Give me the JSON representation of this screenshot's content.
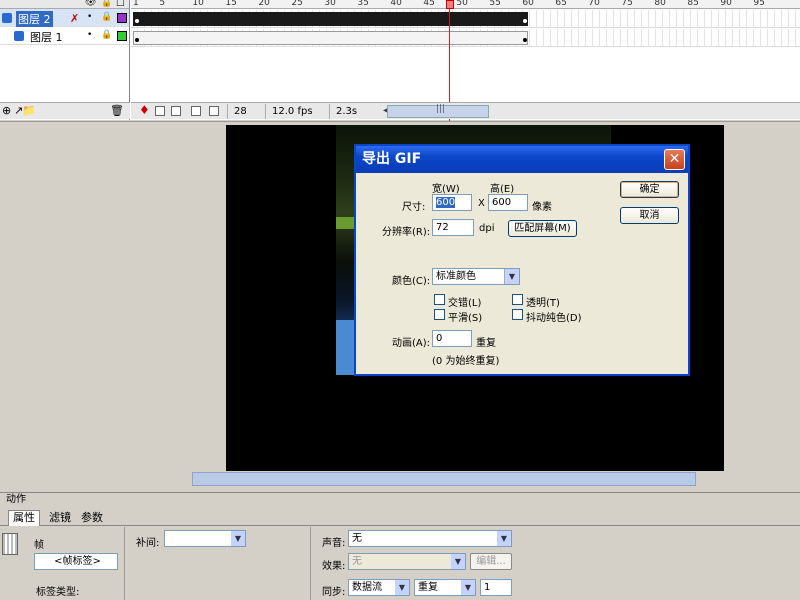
{
  "timeline": {
    "ruler_ticks": [
      "1",
      "5",
      "10",
      "15",
      "20",
      "25",
      "30",
      "35",
      "40",
      "45",
      "50",
      "55",
      "60",
      "65",
      "70",
      "75",
      "80",
      "85",
      "90",
      "95"
    ],
    "layers": [
      {
        "name": "图层 2",
        "selected": true,
        "color": "#9933cc"
      },
      {
        "name": "图层 1",
        "selected": false,
        "color": "#33cc33"
      }
    ],
    "current_frame": "28",
    "fps": "12.0 fps",
    "elapsed": "2.3s"
  },
  "dialog": {
    "title": "导出 GIF",
    "width_label": "宽(W)",
    "height_label": "高(E)",
    "size_label": "尺寸:",
    "width_value": "600",
    "x_sep": "X",
    "height_value": "600",
    "unit": "像素",
    "resolution_label": "分辨率(R):",
    "resolution_value": "72",
    "dpi": "dpi",
    "match_screen": "匹配屏幕(M)",
    "color_label": "颜色(C):",
    "color_value": "标准颜色",
    "interlace": "交错(L)",
    "transparent": "透明(T)",
    "smooth": "平滑(S)",
    "dither": "抖动纯色(D)",
    "animation_label": "动画(A):",
    "animation_value": "0",
    "repeat": "重复",
    "repeat_hint": "(0 为始终重复)",
    "ok": "确定",
    "cancel": "取消",
    "close_glyph": "✕"
  },
  "panels": {
    "actions": "动作",
    "tabs": [
      "属性",
      "滤镜",
      "参数"
    ],
    "frame_label": "帧",
    "frame_label_input": "<帧标签>",
    "label_type": "标签类型:",
    "tween_label": "补间:",
    "tween_value": "",
    "sound_label": "声音:",
    "sound_value": "无",
    "effect_label": "效果:",
    "effect_value": "无",
    "edit_button": "编辑...",
    "sync_label": "同步:",
    "sync_value": "数据流",
    "repeat_value": "重复",
    "repeat_count": "1"
  }
}
